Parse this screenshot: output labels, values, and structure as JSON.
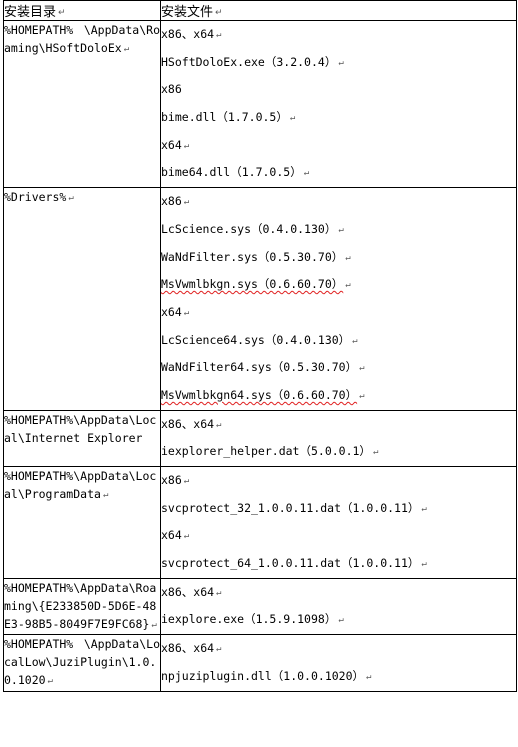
{
  "table": {
    "headers": [
      "安装目录",
      "安装文件"
    ],
    "paragraph_mark": "↵",
    "rows": [
      {
        "dir": "%HOMEPATH% \\AppData\\Roaming\\HSoftDoloEx",
        "files": [
          "x86、x64",
          "HSoftDoloEx.exe（3.2.0.4）",
          "x86",
          "bime.dll（1.7.0.5）",
          "x64",
          "bime64.dll（1.7.0.5）"
        ]
      },
      {
        "dir": "%Drivers%",
        "files": [
          "x86",
          "LcScience.sys（0.4.0.130）",
          "WaNdFilter.sys（0.5.30.70）",
          "MsVwmlbkgn.sys（0.6.60.70）",
          "x64",
          "LcScience64.sys（0.4.0.130）",
          "WaNdFilter64.sys（0.5.30.70）",
          "MsVwmlbkgn64.sys（0.6.60.70）"
        ]
      },
      {
        "dir": "%HOMEPATH%\\AppData\\Local\\Internet Explorer",
        "files": [
          "x86、x64",
          "iexplorer_helper.dat（5.0.0.1）"
        ]
      },
      {
        "dir": "%HOMEPATH%\\AppData\\Local\\ProgramData",
        "files": [
          "x86",
          "svcprotect_32_1.0.0.11.dat（1.0.0.11）",
          "x64",
          "svcprotect_64_1.0.0.11.dat（1.0.0.11）"
        ]
      },
      {
        "dir": "%HOMEPATH%\\AppData\\Roaming\\{E233850D-5D6E-48E3-98B5-8049F7E9FC68}",
        "files": [
          "x86、x64",
          "iexplore.exe（1.5.9.1098）"
        ]
      },
      {
        "dir": "%HOMEPATH% \\AppData\\LocalLow\\JuziPlugin\\1.0.0.1020",
        "files": [
          "x86、x64",
          "npjuziplugin.dll（1.0.0.1020）"
        ]
      }
    ]
  }
}
